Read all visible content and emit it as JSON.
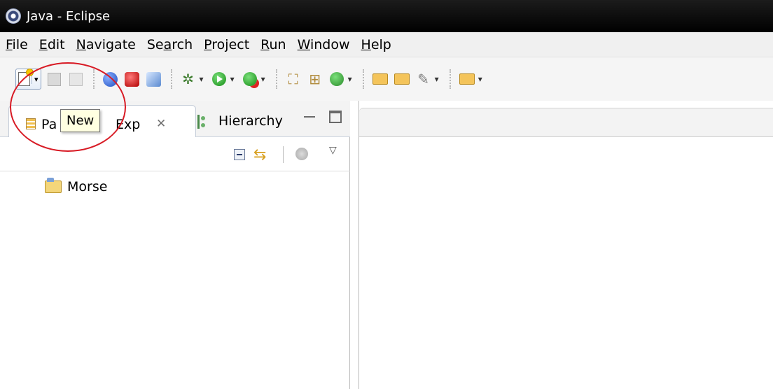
{
  "window": {
    "title": "Java - Eclipse"
  },
  "menu": {
    "items": [
      {
        "label": "File",
        "mnemonic": "F",
        "rest": "ile"
      },
      {
        "label": "Edit",
        "mnemonic": "E",
        "rest": "dit"
      },
      {
        "label": "Navigate",
        "mnemonic": "N",
        "rest": "avigate"
      },
      {
        "label": "Search",
        "pre": "Se",
        "mnemonic": "a",
        "rest": "rch"
      },
      {
        "label": "Project",
        "mnemonic": "P",
        "rest": "roject"
      },
      {
        "label": "Run",
        "mnemonic": "R",
        "rest": "un"
      },
      {
        "label": "Window",
        "mnemonic": "W",
        "rest": "indow"
      },
      {
        "label": "Help",
        "mnemonic": "H",
        "rest": "elp"
      }
    ]
  },
  "toolbar": {
    "icons": [
      "new-icon",
      "save-icon",
      "save-all-icon",
      "globe-icon",
      "red-plugin-icon",
      "blue-plugin-icon",
      "debug-icon",
      "run-icon",
      "external-tools-icon",
      "new-java-project-icon",
      "new-package-icon",
      "new-class-icon",
      "open-type-icon",
      "open-folder-icon",
      "search-pencil-icon",
      "folder-icon"
    ]
  },
  "left_view": {
    "tab_active_part1": "Pa",
    "tab_active_part2": "Exp",
    "tab_inactive": "Hierarchy",
    "tree": [
      {
        "label": "Morse",
        "icon": "java-project-icon"
      }
    ]
  },
  "tooltip": {
    "text": "New"
  },
  "colors": {
    "annotation": "#d81b25",
    "tooltip_bg": "#ffffe1",
    "titlebar": "#000000"
  }
}
